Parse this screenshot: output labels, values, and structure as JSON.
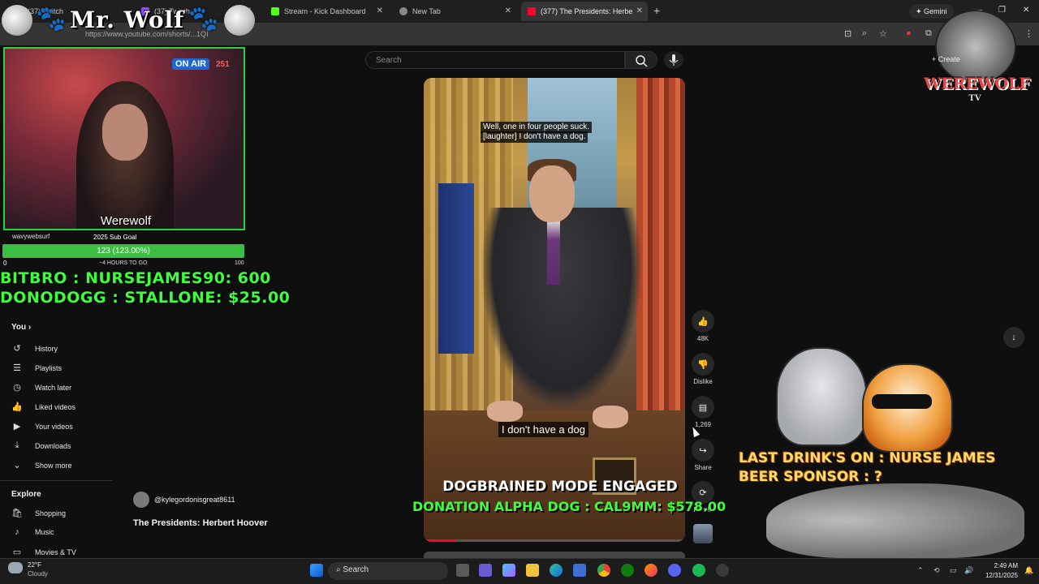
{
  "browser": {
    "tabs": [
      {
        "label": "(37) Twitch",
        "active": false
      },
      {
        "label": "(37) Twitch",
        "active": false
      },
      {
        "label": "Stream - Kick Dashboard",
        "active": false
      },
      {
        "label": "New Tab",
        "active": false
      },
      {
        "label": "(377) The Presidents: Herbe",
        "active": true
      }
    ],
    "gemini_label": "Gemini",
    "url": "https://www.youtube.com/shorts/...1QI",
    "icons": [
      "close-icon",
      "plus-icon",
      "minimize-icon",
      "maximize-icon",
      "star-icon",
      "extensions-icon",
      "menu-icon"
    ]
  },
  "youtube": {
    "search_placeholder": "Search",
    "create_label": "Create",
    "sidebar": {
      "you_label": "You",
      "items": [
        {
          "label": "History",
          "icon": "history-icon"
        },
        {
          "label": "Playlists",
          "icon": "playlists-icon"
        },
        {
          "label": "Watch later",
          "icon": "watch-later-icon"
        },
        {
          "label": "Liked videos",
          "icon": "like-icon"
        },
        {
          "label": "Your videos",
          "icon": "your-videos-icon"
        },
        {
          "label": "Downloads",
          "icon": "download-icon"
        },
        {
          "label": "Show more",
          "icon": "chevron-down-icon"
        }
      ],
      "explore_label": "Explore",
      "explore_items": [
        {
          "label": "Shopping",
          "icon": "shopping-icon"
        },
        {
          "label": "Music",
          "icon": "music-icon"
        },
        {
          "label": "Movies & TV",
          "icon": "movies-icon"
        }
      ]
    },
    "video": {
      "caption_top_line1": "Well, one in four people suck.",
      "caption_top_line2": "[laughter] I don't have a dog.",
      "caption_bottom": "I don't have a dog",
      "channel": "@kylegordonisgreat8611",
      "title": "The Presidents: Herbert Hoover",
      "progress": 0.12
    },
    "actions": {
      "like_count": "48K",
      "dislike_label": "Dislike",
      "comment_count": "1,269",
      "share_label": "Share",
      "remix_label": "Remix"
    }
  },
  "overlay": {
    "logo_text": "Mr. Wolf",
    "webcam_name": "Werewolf",
    "webcam_sign": "ON AIR",
    "webcam_sign2": "251",
    "goal": {
      "user": "wavywebsurf",
      "title": "2025 Sub Goal",
      "value": "123 (123.00%)",
      "min": "0",
      "time": "~4 HOURS TO GO",
      "max": "100"
    },
    "ticker1": "BITBRO : NURSEJAMES90: 600",
    "ticker2": "DONODOGG : STALLONE: $25.00",
    "mode": "DOGBRAINED MODE ENGAGED",
    "donation": "DONATION ALPHA DOG : CAL9MM: $578.00",
    "drink1": "LAST DRINK'S ON : NURSE JAMES",
    "drink2": "BEER SPONSOR : ?",
    "werewolf_logo": "WEREWOLF",
    "werewolf_tv": "TV"
  },
  "taskbar": {
    "weather_temp": "22°F",
    "weather_desc": "Cloudy",
    "search_label": "Search",
    "time": "2:49 AM",
    "date": "12/31/2025"
  }
}
